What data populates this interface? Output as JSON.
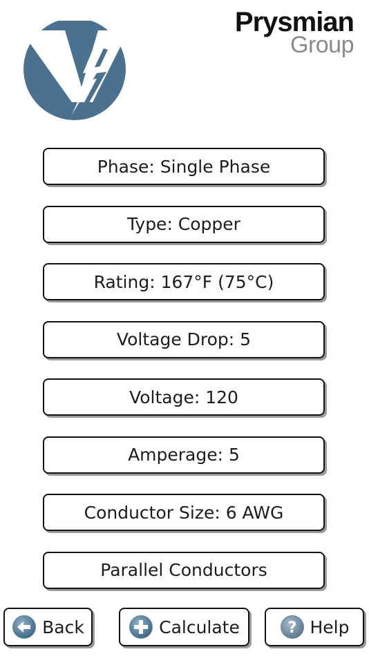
{
  "header": {
    "app_logo_icon": "lightning-v-logo-icon",
    "brand_name": "Prysmian",
    "brand_sub": "Group",
    "logo_color": "#4a7290"
  },
  "options": [
    {
      "label": "Phase: Single Phase"
    },
    {
      "label": "Type: Copper"
    },
    {
      "label": "Rating: 167°F (75°C)"
    },
    {
      "label": "Voltage Drop: 5"
    },
    {
      "label": "Voltage: 120"
    },
    {
      "label": "Amperage: 5"
    },
    {
      "label": "Conductor Size: 6 AWG"
    },
    {
      "label": "Parallel Conductors"
    }
  ],
  "actions": {
    "back": {
      "label": "Back",
      "icon": "arrow-left-circle-icon"
    },
    "calculate": {
      "label": "Calculate",
      "icon": "plus-circle-icon"
    },
    "help": {
      "label": "Help",
      "icon": "question-circle-icon"
    }
  },
  "colors": {
    "accent": "#4a7290",
    "border": "#111111",
    "shadow": "#9a9a9a"
  }
}
